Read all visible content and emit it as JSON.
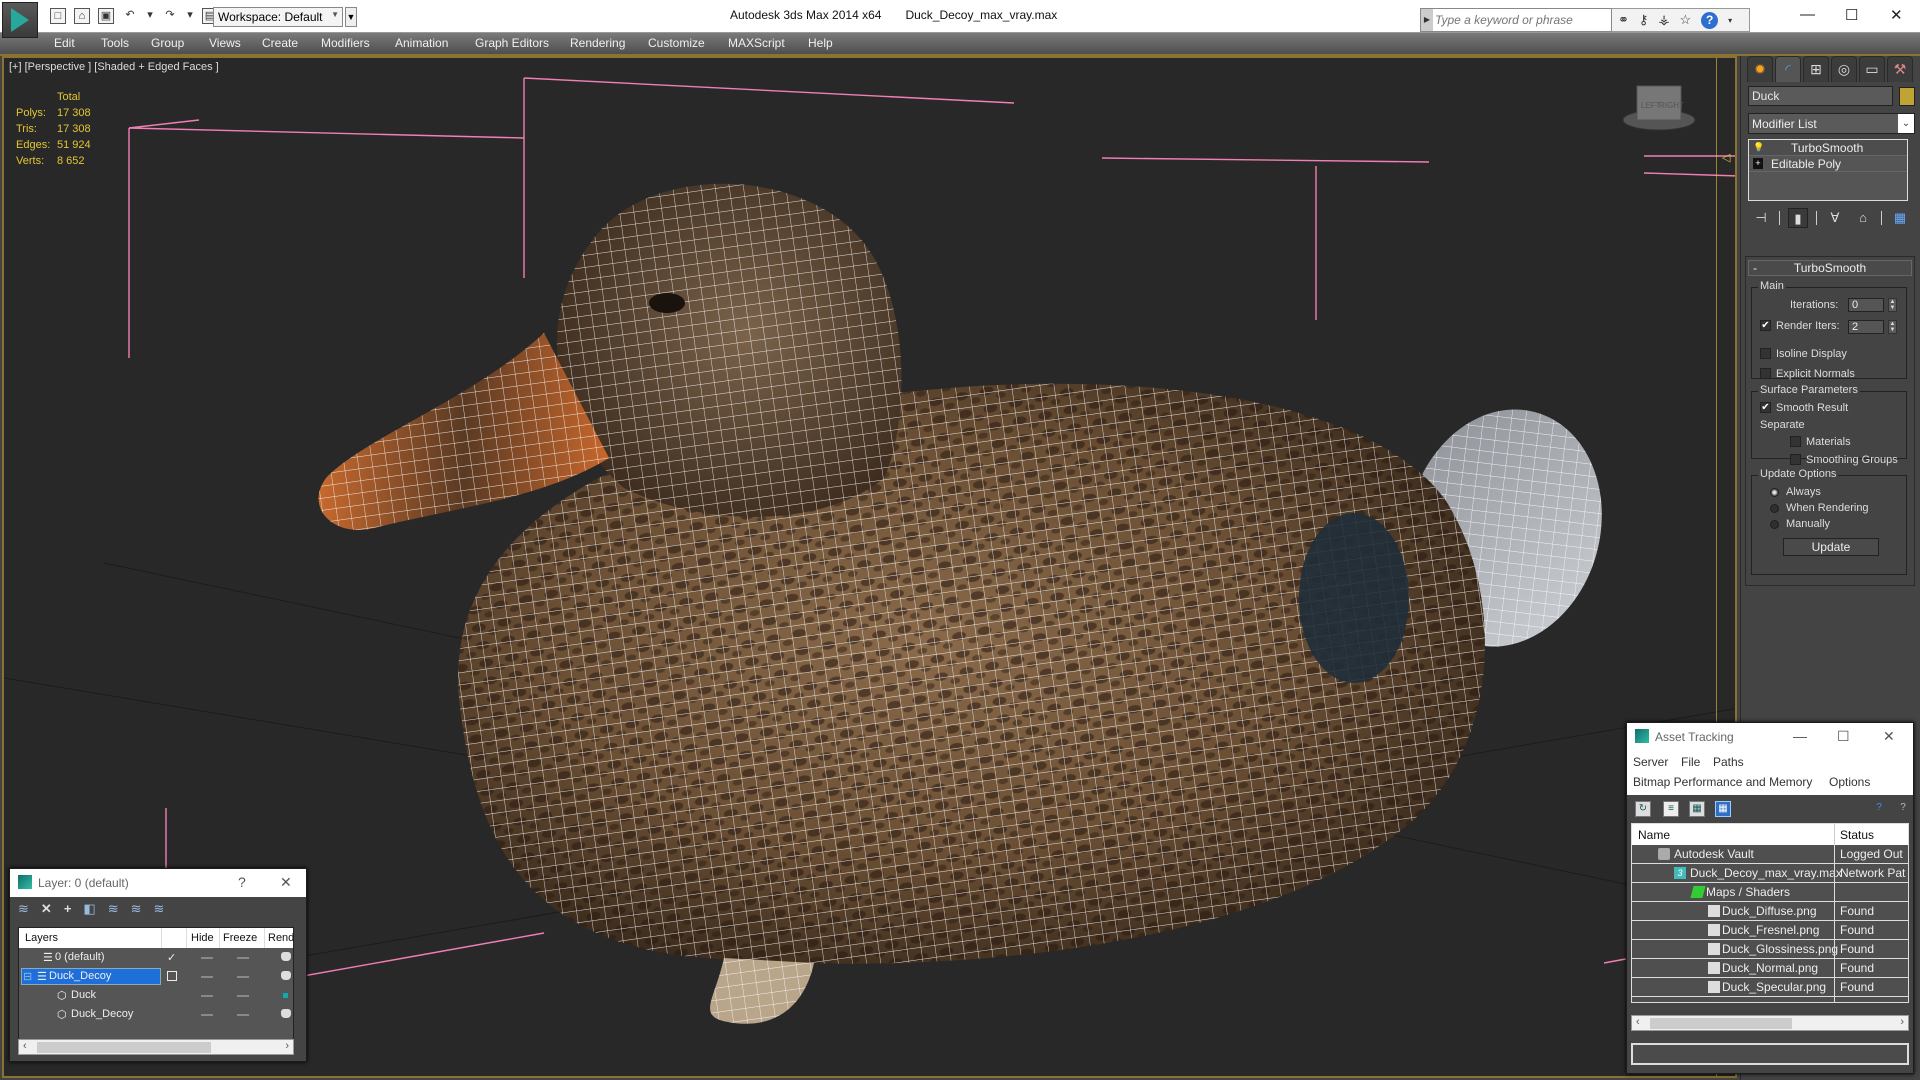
{
  "app": {
    "title": "Autodesk 3ds Max  2014 x64",
    "file": "Duck_Decoy_max_vray.max",
    "workspace": "Workspace: Default",
    "search_placeholder": "Type a keyword or phrase",
    "help_label": "?"
  },
  "quick_access": [
    "new-file",
    "open-file",
    "save-file",
    "undo",
    "redo",
    "project-folder"
  ],
  "menu": [
    "Edit",
    "Tools",
    "Group",
    "Views",
    "Create",
    "Modifiers",
    "Animation",
    "Graph Editors",
    "Rendering",
    "Customize",
    "MAXScript",
    "Help"
  ],
  "viewport": {
    "label": "[+] [Perspective ] [Shaded + Edged Faces ]",
    "stats_header": "Total",
    "stats": [
      {
        "label": "Polys:",
        "value": "17 308"
      },
      {
        "label": "Tris:",
        "value": "17 308"
      },
      {
        "label": "Edges:",
        "value": "51 924"
      },
      {
        "label": "Verts:",
        "value": "8 652"
      }
    ],
    "viewcube_labels": [
      "LEFT",
      "RIGHT"
    ],
    "colors": {
      "selection_box": "#f07fb6",
      "wire": "#ffffff",
      "background": "#282828",
      "border": "#8a7230"
    }
  },
  "command_panel": {
    "tabs": [
      "create",
      "modify",
      "hierarchy",
      "motion",
      "display",
      "utilities"
    ],
    "object_name": "Duck",
    "object_color": "#bfa334",
    "modifier_list": "Modifier List",
    "stack": [
      {
        "label": "TurboSmooth",
        "icon": "bulb"
      },
      {
        "label": "Editable Poly",
        "icon": "plus"
      }
    ],
    "rollout": {
      "title": "TurboSmooth",
      "collapse": "-",
      "main_group": "Main",
      "iterations_label": "Iterations:",
      "iterations_value": "0",
      "render_iters_label": "Render Iters:",
      "render_iters_value": "2",
      "render_iters_checked": true,
      "isoline_label": "Isoline Display",
      "isoline_checked": false,
      "explicit_normals_label": "Explicit Normals",
      "explicit_normals_checked": false,
      "surface_group": "Surface Parameters",
      "smooth_result_label": "Smooth Result",
      "smooth_result_checked": true,
      "separate_label": "Separate",
      "materials_label": "Materials",
      "smoothing_groups_label": "Smoothing Groups",
      "update_group": "Update Options",
      "update_options": [
        "Always",
        "When Rendering",
        "Manually"
      ],
      "update_selected": "Always",
      "update_button": "Update"
    }
  },
  "layer_manager": {
    "title": "Layer: 0 (default)",
    "help": "?",
    "close": "✕",
    "columns": [
      "Layers",
      "",
      "Hide",
      "Freeze",
      "Rend"
    ],
    "rows": [
      {
        "name": "0 (default)",
        "type": "layer",
        "current": true,
        "selected": false,
        "indent": 1
      },
      {
        "name": "Duck_Decoy",
        "type": "layer",
        "current": false,
        "selected": true,
        "indent": 1
      },
      {
        "name": "Duck",
        "type": "object",
        "current": false,
        "selected": false,
        "indent": 2
      },
      {
        "name": "Duck_Decoy",
        "type": "object",
        "current": false,
        "selected": false,
        "indent": 2
      }
    ]
  },
  "asset_tracking": {
    "title": "Asset Tracking",
    "menu_row1": [
      "Server",
      "File",
      "Paths"
    ],
    "menu_row2": [
      "Bitmap Performance and Memory",
      "Options"
    ],
    "columns": [
      "Name",
      "Status"
    ],
    "rows": [
      {
        "name": "Autodesk Vault",
        "status": "Logged Out",
        "indent": 1,
        "icon": "vault"
      },
      {
        "name": "Duck_Decoy_max_vray.max",
        "status": "Network Pat",
        "indent": 2,
        "icon": "max-file"
      },
      {
        "name": "Maps / Shaders",
        "status": "",
        "indent": 3,
        "icon": "maps"
      },
      {
        "name": "Duck_Diffuse.png",
        "status": "Found",
        "indent": 4,
        "icon": "png"
      },
      {
        "name": "Duck_Fresnel.png",
        "status": "Found",
        "indent": 4,
        "icon": "png"
      },
      {
        "name": "Duck_Glossiness.png",
        "status": "Found",
        "indent": 4,
        "icon": "png"
      },
      {
        "name": "Duck_Normal.png",
        "status": "Found",
        "indent": 4,
        "icon": "png"
      },
      {
        "name": "Duck_Specular.png",
        "status": "Found",
        "indent": 4,
        "icon": "png"
      }
    ]
  }
}
